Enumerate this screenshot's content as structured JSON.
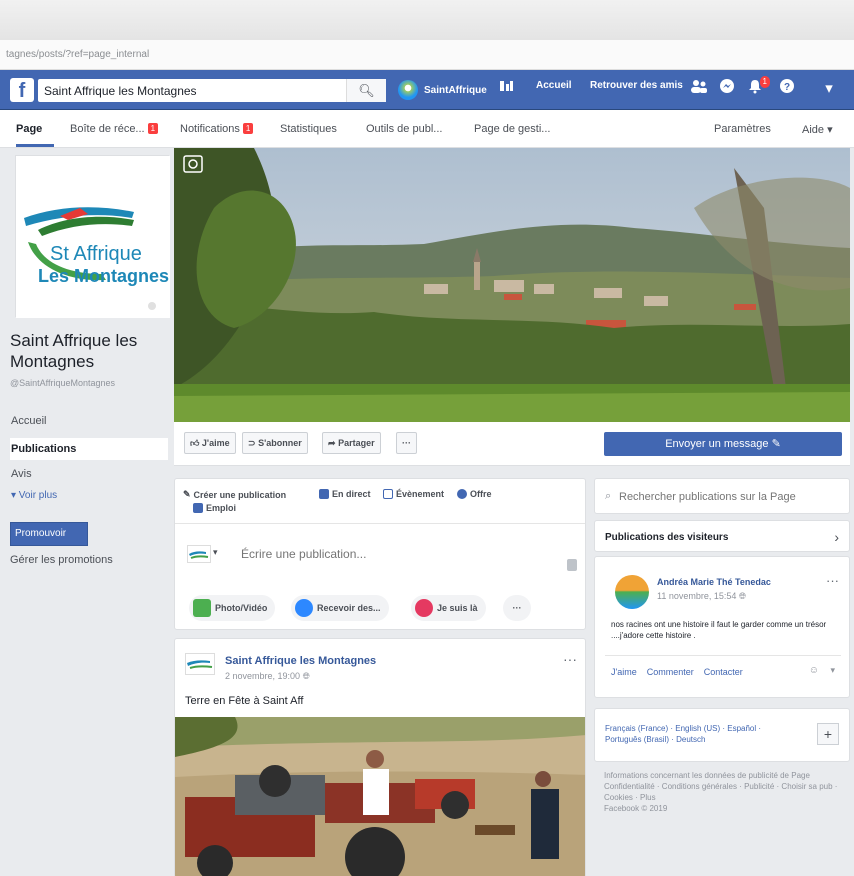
{
  "browser": {
    "url": "tagnes/posts/?ref=page_internal"
  },
  "fb_bar": {
    "search_value": "Saint Affrique les Montagnes",
    "profile_name": "SaintAffrique",
    "nav_home": "Accueil",
    "nav_find_friends": "Retrouver des amis",
    "notif_count": "1"
  },
  "page_tabs": {
    "page": "Page",
    "inbox": "Boîte de réce...",
    "inbox_badge": "1",
    "notifications": "Notifications",
    "notifications_badge": "1",
    "stats": "Statistiques",
    "publishing_tools": "Outils de publ...",
    "page_quality": "Page de gesti...",
    "settings": "Paramètres",
    "help": "Aide ▾"
  },
  "page": {
    "logo_line1": "St Affrique",
    "logo_line2": "Les Montagnes",
    "name": "Saint Affrique les Montagnes",
    "handle": "@SaintAffriqueMontagnes",
    "nav": {
      "home": "Accueil",
      "posts": "Publications",
      "reviews": "Avis",
      "more": "▾ Voir plus"
    },
    "promote_button": "Promouvoir",
    "manage_promotions": "Gérer les promotions"
  },
  "actions": {
    "like": "J'aime",
    "follow": "S'abonner",
    "share": "Partager",
    "more": "···",
    "send_message": "Envoyer un message ✎"
  },
  "composer": {
    "create_post": "Créer une publication",
    "live": "En direct",
    "event": "Évènement",
    "offer": "Offre",
    "job": "Emploi",
    "placeholder": "Écrire une publication...",
    "photo_video": "Photo/Vidéo",
    "receive": "Recevoir des...",
    "checkin": "Je suis là",
    "more": "···"
  },
  "post": {
    "author": "Saint Affrique les Montagnes",
    "time": "2 novembre, 19:00",
    "text": "Terre en Fête à Saint Aff",
    "menu": "···"
  },
  "right": {
    "search_placeholder": "Rechercher publications sur la Page",
    "visitor_posts_title": "Publications des visiteurs",
    "visitor_author": "Andréa Marie Thé Tenedac",
    "visitor_time": "11 novembre, 15:54",
    "visitor_text": "nos racines ont une histoire il faut le garder comme un trésor ....j'adore cette histoire .",
    "visitor_actions": {
      "like": "J'aime",
      "comment": "Commenter",
      "contact": "Contacter"
    },
    "visitor_menu": "···",
    "languages": "Français (France) · English (US) · Español · Português (Brasil) · Deutsch",
    "add_language": "+",
    "footer_line1": "Informations concernant les données de publicité de Page",
    "footer_line2": "Confidentialité · Conditions générales · Publicité · Choisir sa pub · Cookies · Plus",
    "footer_line3": "Facebook © 2019"
  }
}
